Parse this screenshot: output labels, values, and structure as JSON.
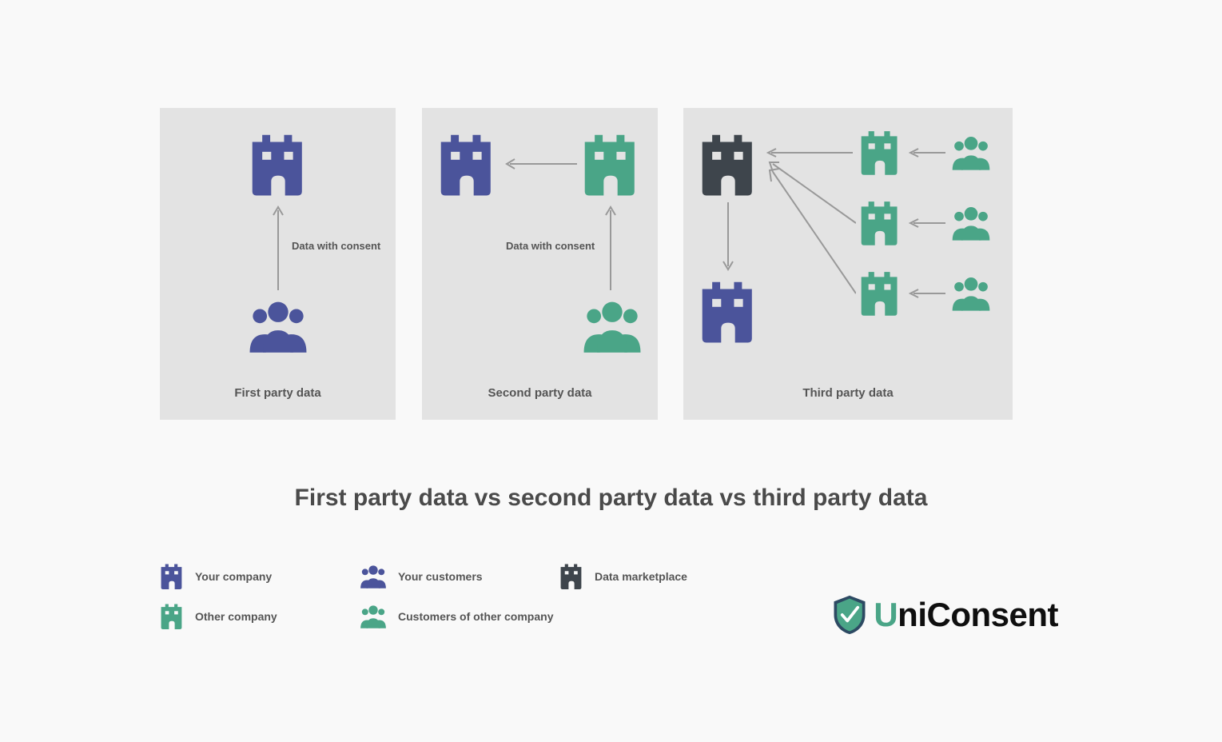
{
  "title": "First party data vs second party data vs third party data",
  "panels": {
    "first": {
      "caption": "First party data",
      "arrow_label": "Data with consent"
    },
    "second": {
      "caption": "Second party data",
      "arrow_label": "Data with consent"
    },
    "third": {
      "caption": "Third party data"
    }
  },
  "legend": {
    "your_company": "Your company",
    "your_customers": "Your customers",
    "data_marketplace": "Data marketplace",
    "other_company": "Other company",
    "customers_other": "Customers of other company"
  },
  "brand": {
    "name": "UniConsent",
    "accent_prefix": "U",
    "rest": "niConsent"
  },
  "colors": {
    "your_company": "#4b549b",
    "your_customers": "#4b549b",
    "other_company": "#4aa587",
    "customers_other": "#4aa587",
    "marketplace": "#3e454c"
  }
}
